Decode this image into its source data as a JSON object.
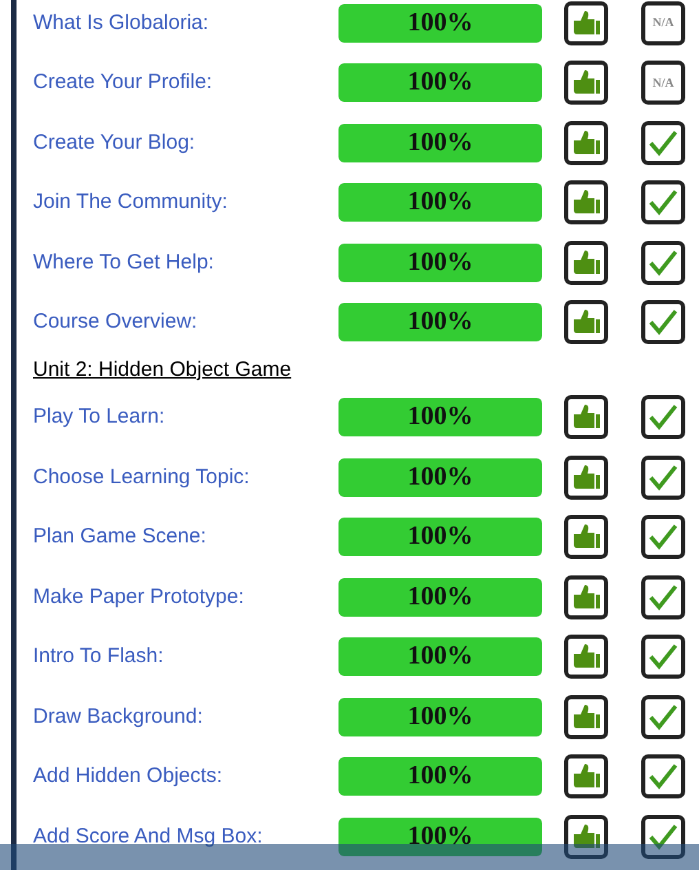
{
  "items": [
    {
      "kind": "row",
      "label": "What Is Globaloria:",
      "level": 1,
      "reading": "100%",
      "status": {
        "kind": "text",
        "text": "N/A"
      }
    },
    {
      "kind": "row",
      "label": "Create Your Profile:",
      "level": 1,
      "reading": "100%",
      "status": {
        "kind": "text",
        "text": "N/A"
      }
    },
    {
      "kind": "row",
      "label": "Create Your Blog:",
      "level": 1,
      "reading": "100%",
      "status": {
        "kind": "check"
      }
    },
    {
      "kind": "row",
      "label": "Join The Community:",
      "level": 1,
      "reading": "100%",
      "status": {
        "kind": "check"
      }
    },
    {
      "kind": "row",
      "label": "Where To Get Help:",
      "level": 1,
      "reading": "100%",
      "status": {
        "kind": "check"
      }
    },
    {
      "kind": "row",
      "label": "Course Overview:",
      "level": 1,
      "reading": "100%",
      "status": {
        "kind": "check"
      }
    },
    {
      "kind": "heading",
      "label": "Unit 2: Hidden Object Game"
    },
    {
      "kind": "row",
      "label": "Play To Learn:",
      "level": 1,
      "reading": "100%",
      "status": {
        "kind": "check"
      }
    },
    {
      "kind": "row",
      "label": "Choose Learning Topic:",
      "level": 1,
      "reading": "100%",
      "status": {
        "kind": "check"
      }
    },
    {
      "kind": "row",
      "label": "Plan Game Scene:",
      "level": 1,
      "reading": "100%",
      "status": {
        "kind": "check"
      }
    },
    {
      "kind": "row",
      "label": "Make Paper Prototype:",
      "level": 1,
      "reading": "100%",
      "status": {
        "kind": "check"
      }
    },
    {
      "kind": "row",
      "label": "Intro To Flash:",
      "level": 1,
      "reading": "100%",
      "status": {
        "kind": "check"
      }
    },
    {
      "kind": "row",
      "label": "Draw Background:",
      "level": 1,
      "reading": "100%",
      "status": {
        "kind": "check"
      }
    },
    {
      "kind": "row",
      "label": "Add Hidden Objects:",
      "level": 1,
      "reading": "100%",
      "status": {
        "kind": "check"
      }
    },
    {
      "kind": "row",
      "label": "Add Score And Msg Box:",
      "level": 1,
      "reading": "100%",
      "status": {
        "kind": "check"
      }
    }
  ]
}
